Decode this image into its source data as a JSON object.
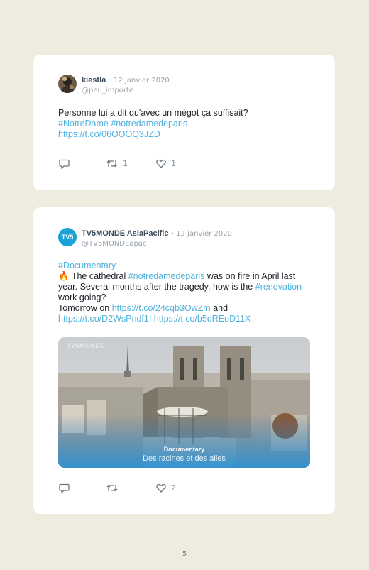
{
  "tweets": [
    {
      "name": "kiestla",
      "date": "· 12 janvier 2020",
      "handle": "@peu_importe",
      "line1": "Personne lui a dit qu'avec un mégot ça suffisait?",
      "tag1": "#NotreDame",
      "tag2": "#notredamedeparis",
      "url1": "https://t.co/06OOOQ3JZD",
      "retweets": "1",
      "likes": "1"
    },
    {
      "name": "TV5MONDE AsiaPacific",
      "date": "· 12 janvier 2020",
      "handle": "@TV5MONDEapac",
      "avatar_text": "TV5",
      "tag_doc": "#Documentary",
      "emoji": "🔥",
      "l2a": " The cathedral ",
      "tag_nd": "#notredamedeparis",
      "l2b": " was on fire in April last year. Several months after the tragedy, how is the ",
      "tag_ren": "#renovation",
      "l2c": " work going?",
      "l3a": "Tomorrow on ",
      "url_a": "https://t.co/24cqb3OwZm",
      "l3b": " and",
      "url_b": "https://t.co/D2WsPndf1I",
      "url_c": "https://t.co/b5dREoD11X",
      "media": {
        "watermark": "TV5MONDE",
        "caption_title": "Documentary",
        "caption_sub": "Des racines et des ailes"
      },
      "likes": "2"
    }
  ],
  "page_number": "5",
  "colors": {
    "link": "#4fb1de",
    "background": "#efebdf"
  }
}
